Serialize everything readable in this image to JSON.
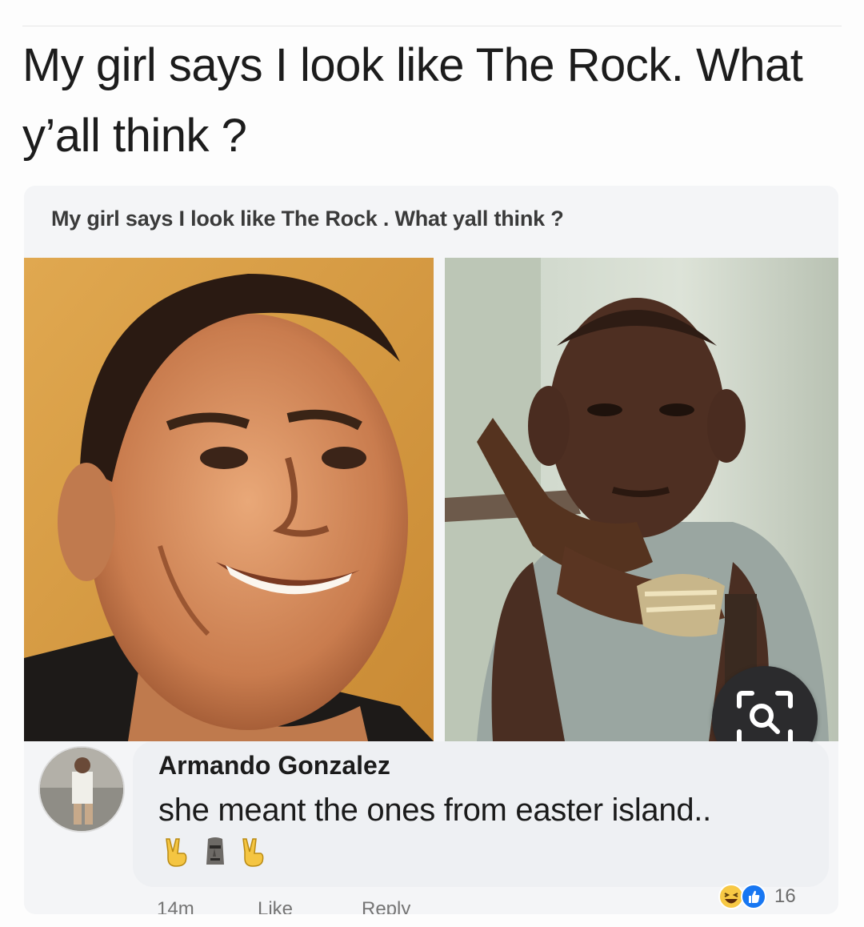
{
  "headline": "My girl says I look like The Rock. What y’all think ?",
  "post": {
    "caption": "My girl says I look like The Rock . What yall think ?"
  },
  "comment": {
    "author": "Armando Gonzalez",
    "text": "she meant the ones from easter island..",
    "emojis": [
      "victory-hand-icon",
      "moai-icon",
      "victory-hand-icon"
    ],
    "time": "14m",
    "like_label": "Like",
    "reply_label": "Reply",
    "reaction_icons": [
      "laughing-emoji-icon",
      "like-thumb-icon"
    ],
    "reaction_count": "16"
  },
  "overlay": {
    "lens_icon": "visual-search-icon"
  }
}
